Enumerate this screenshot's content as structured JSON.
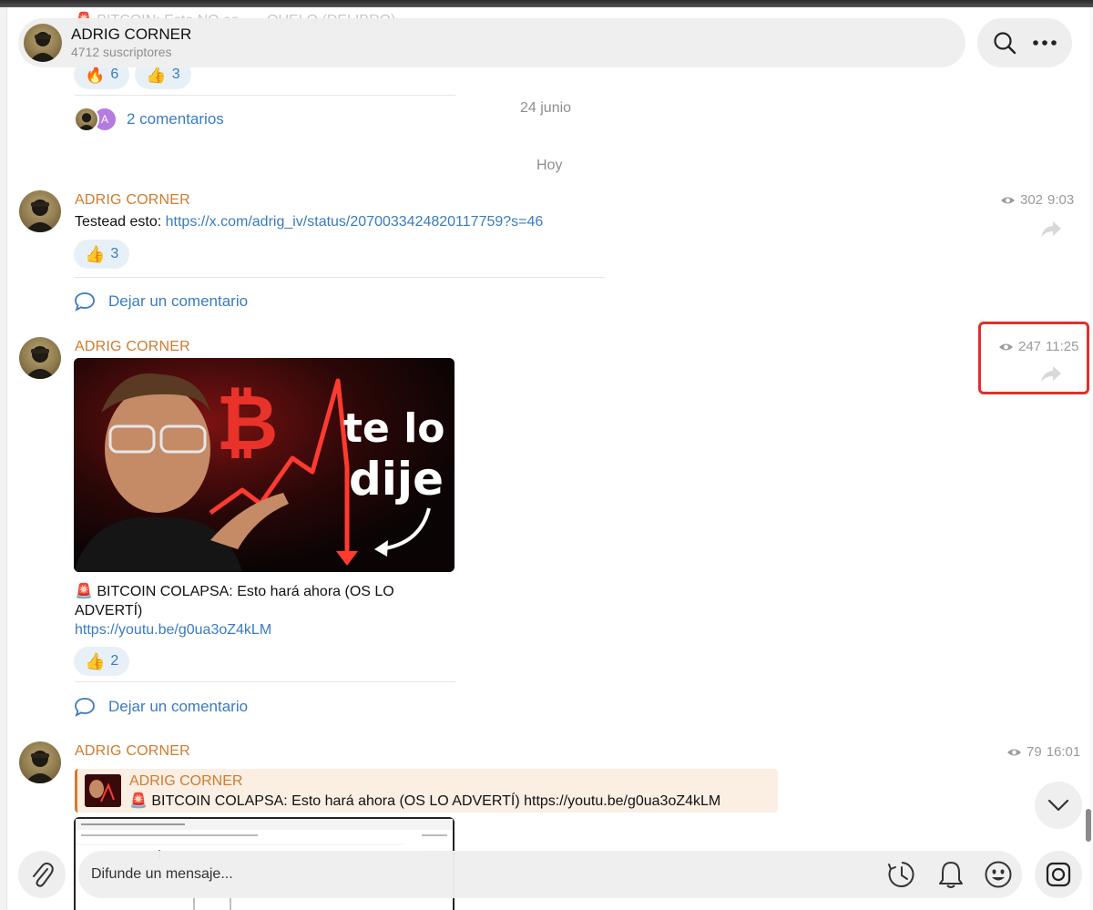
{
  "header": {
    "title": "ADRIG CORNER",
    "subtitle": "4712 suscriptores"
  },
  "top_partial": {
    "text": "🚨 BITCOIN: Esto NO es... ...QUELO (DELIBRO)",
    "reactions": [
      {
        "emoji": "🔥",
        "count": "6"
      },
      {
        "emoji": "👍",
        "count": "3"
      }
    ],
    "comments": {
      "avatar_letter": "A",
      "label": "2 comentarios"
    }
  },
  "date_separators": {
    "first": "24 junio",
    "second": "Hoy"
  },
  "messages": [
    {
      "sender": "ADRIG CORNER",
      "text_prefix": "Testead esto: ",
      "link": "https://x.com/adrig_iv/status/2070033424820117759?s=46",
      "views": "302",
      "time": "9:03",
      "reactions": [
        {
          "emoji": "👍",
          "count": "3"
        }
      ],
      "comment_label": "Dejar un comentario"
    },
    {
      "sender": "ADRIG CORNER",
      "thumbnail_text": [
        "te lo",
        "dije"
      ],
      "title_emoji": "🚨",
      "title_line1": "BITCOIN COLAPSA: Esto hará ahora (OS LO",
      "title_line2": "ADVERTÍ)",
      "link": "https://youtu.be/g0ua3oZ4kLM",
      "views": "247",
      "time": "11:25",
      "reactions": [
        {
          "emoji": "👍",
          "count": "2"
        }
      ],
      "comment_label": "Dejar un comentario"
    },
    {
      "sender": "ADRIG CORNER",
      "views": "79",
      "time": "16:01",
      "forwarded": {
        "sender": "ADRIG CORNER",
        "text": "🚨 BITCOIN COLAPSA: Esto hará ahora (OS LO ADVERTÍ) https://youtu.be/g0ua3oZ4kLM"
      }
    }
  ],
  "composer": {
    "placeholder": "Difunde un mensaje..."
  },
  "icons": [
    "search-icon",
    "more-icon",
    "eye-icon",
    "share-icon",
    "comment-icon",
    "attach-icon",
    "schedule-icon",
    "bell-icon",
    "emoji-icon",
    "camera-icon",
    "chevron-down-icon"
  ],
  "colors": {
    "accent_link": "#3a7bbf",
    "sender_name": "#d07b2e",
    "highlight": "#e0302a"
  }
}
